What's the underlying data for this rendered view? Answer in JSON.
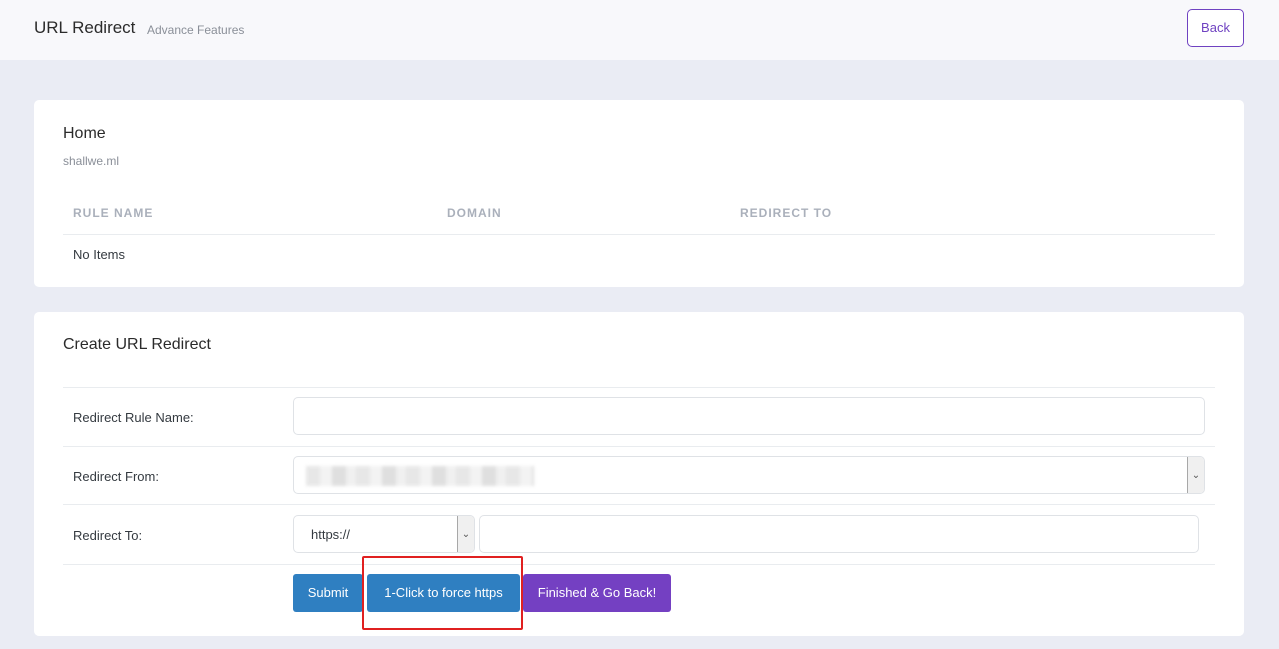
{
  "header": {
    "title": "URL Redirect",
    "subtitle": "Advance Features",
    "back_label": "Back"
  },
  "home_card": {
    "title": "Home",
    "domain": "shallwe.ml",
    "columns": [
      "RULE NAME",
      "DOMAIN",
      "REDIRECT TO"
    ],
    "empty_text": "No Items"
  },
  "create_card": {
    "title": "Create URL Redirect",
    "fields": {
      "rule_name_label": "Redirect Rule Name:",
      "rule_name_value": "",
      "from_label": "Redirect From:",
      "to_label": "Redirect To:",
      "protocol_selected": "https://",
      "target_value": ""
    },
    "buttons": {
      "submit": "Submit",
      "force_https": "1-Click to force https",
      "finish": "Finished & Go Back!"
    }
  },
  "colors": {
    "primary_blue": "#2f7fc1",
    "purple": "#7440c2",
    "highlight_red": "#e02020",
    "background": "#eaecf4"
  }
}
